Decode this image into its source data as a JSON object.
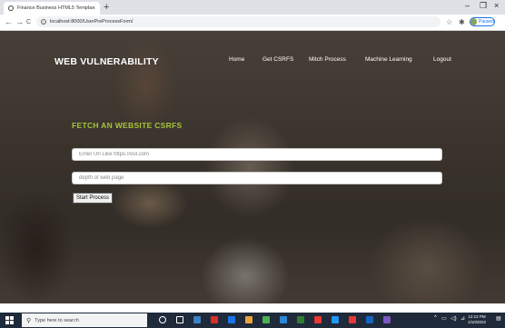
{
  "browser": {
    "tab_title": "Finance Business HTML5 Templa",
    "tab_close": "×",
    "new_tab": "+",
    "window_controls": {
      "minimize": "–",
      "maximize": "❐",
      "close": "×"
    },
    "back": "←",
    "forward": "→",
    "reload": "C",
    "url": "localhost:8000/UserPreProcessForm/",
    "profile_label": "Paused"
  },
  "site": {
    "brand": "WEB VULNERABILITY",
    "nav": [
      "Home",
      "Get CSRFS",
      "Mitch Process",
      "Machine Learning",
      "Logout"
    ]
  },
  "form": {
    "heading": "FETCH AN WEBSITE CSRFS",
    "url_placeholder": "Enter Url Like https://ool.com",
    "depth_placeholder": "depth of web page",
    "submit_label": "Start Process"
  },
  "taskbar": {
    "search_placeholder": "Type here to search",
    "time": "12:12 PM",
    "date": "1/10/2022",
    "app_colors": [
      "#ffffff",
      "#ffffff",
      "#3b82c4",
      "#d93025",
      "#1a73e8",
      "#e8a33d",
      "#4caf50",
      "#2b88d8",
      "#2e7d32",
      "#e53935",
      "#2196f3",
      "#e53935",
      "#1565c0",
      "#7e57c2"
    ]
  }
}
